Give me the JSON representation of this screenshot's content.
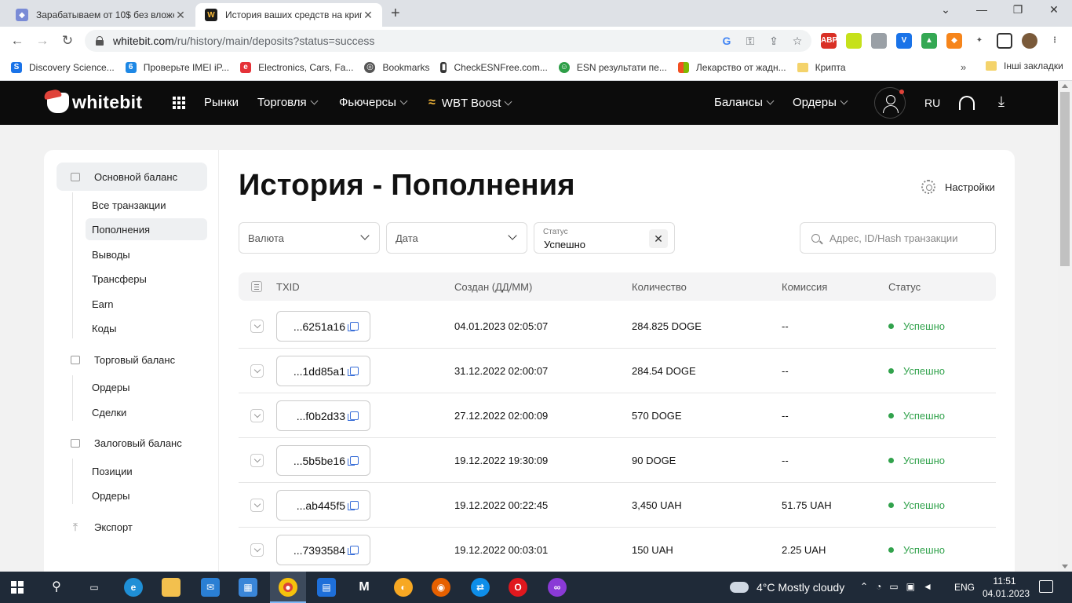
{
  "browser": {
    "tabs": [
      {
        "title": "Зарабатываем от 10$ без вложе",
        "active": false
      },
      {
        "title": "История ваших средств на крип",
        "active": true
      }
    ],
    "url_host": "whitebit.com",
    "url_path": "/ru/history/main/deposits?status=success",
    "bookmarks": [
      "Discovery Science...",
      "Проверьте IMEI iP...",
      "Electronics, Cars, Fa...",
      "Bookmarks",
      "CheckESNFree.com...",
      "ESN результати пе...",
      "Лекарство от жадн...",
      "Крипта"
    ],
    "bookmarks_more": "»",
    "other_bookmarks": "Інші закладки"
  },
  "header": {
    "logo": "whitebit",
    "nav": {
      "markets": "Рынки",
      "trading": "Торговля",
      "futures": "Фьючерсы",
      "wbt_boost": "WBT Boost",
      "balances": "Балансы",
      "orders": "Ордеры"
    },
    "lang": "RU"
  },
  "sidebar": {
    "main_balance": "Основной баланс",
    "main_items": [
      "Все транзакции",
      "Пополнения",
      "Выводы",
      "Трансферы",
      "Earn",
      "Коды"
    ],
    "trade_balance": "Торговый баланс",
    "trade_items": [
      "Ордеры",
      "Сделки"
    ],
    "collateral_balance": "Залоговый баланс",
    "collateral_items": [
      "Позиции",
      "Ордеры"
    ],
    "export": "Экспорт"
  },
  "main": {
    "title": "История - Пополнения",
    "settings": "Настройки",
    "filters": {
      "currency": "Валюта",
      "date": "Дата",
      "status_label": "Статус",
      "status_value": "Успешно",
      "search_placeholder": "Адрес, ID/Hash транзакции"
    },
    "columns": [
      "TXID",
      "Создан (ДД/ММ)",
      "Количество",
      "Комиссия",
      "Статус"
    ],
    "rows": [
      {
        "txid": "...6251a16",
        "created": "04.01.2023 02:05:07",
        "amount": "284.825 DOGE",
        "fee": "--",
        "status": "Успешно"
      },
      {
        "txid": "...1dd85a1",
        "created": "31.12.2022 02:00:07",
        "amount": "284.54 DOGE",
        "fee": "--",
        "status": "Успешно"
      },
      {
        "txid": "...f0b2d33",
        "created": "27.12.2022 02:00:09",
        "amount": "570 DOGE",
        "fee": "--",
        "status": "Успешно"
      },
      {
        "txid": "...5b5be16",
        "created": "19.12.2022 19:30:09",
        "amount": "90 DOGE",
        "fee": "--",
        "status": "Успешно"
      },
      {
        "txid": "...ab445f5",
        "created": "19.12.2022 00:22:45",
        "amount": "3,450 UAH",
        "fee": "51.75 UAH",
        "status": "Успешно"
      },
      {
        "txid": "...7393584",
        "created": "19.12.2022 00:03:01",
        "amount": "150 UAH",
        "fee": "2.25 UAH",
        "status": "Успешно"
      }
    ]
  },
  "taskbar": {
    "weather": "4°C  Mostly cloudy",
    "lang": "ENG",
    "time": "11:51",
    "date": "04.01.2023"
  },
  "colors": {
    "accent_red": "#e0433a",
    "success_green": "#31a24c",
    "link_blue": "#3a6fd8"
  }
}
